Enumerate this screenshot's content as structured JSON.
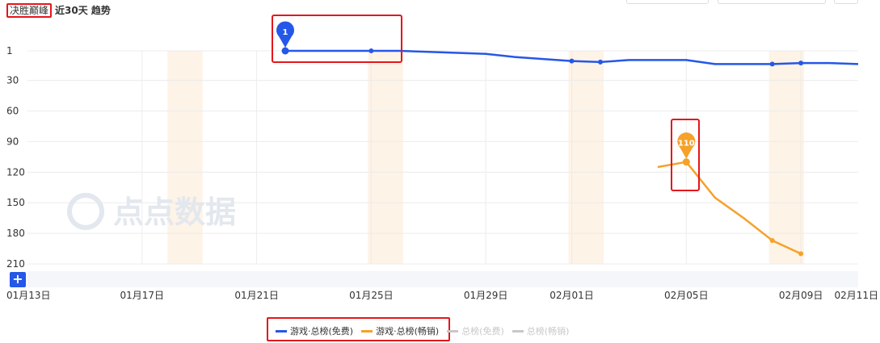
{
  "header": {
    "app_name": "决胜巅峰",
    "period": "近30天 趋势"
  },
  "watermark": "点点数据",
  "zoom_button": "+",
  "colors": {
    "free": "#2557e8",
    "grossing": "#f5a12a",
    "inactive": "#c8c8c8",
    "highlight_box": "#e4161b",
    "band": "#fdf3e6"
  },
  "chart_data": {
    "type": "line",
    "x_tick_labels": [
      "01月13日",
      "01月17日",
      "01月21日",
      "01月25日",
      "01月29日",
      "02月01日",
      "02月05日",
      "02月09日",
      "02月11日"
    ],
    "x_range": [
      "01-13",
      "02-11"
    ],
    "y_tick_labels": [
      "1",
      "30",
      "60",
      "90",
      "120",
      "150",
      "180",
      "210"
    ],
    "y_range": [
      1,
      210
    ],
    "y_inverted": true,
    "grid": true,
    "legend_position": "bottom",
    "weekend_bands": [
      [
        "01-18",
        "01-19"
      ],
      [
        "01-25",
        "01-26"
      ],
      [
        "02-01",
        "02-02"
      ],
      [
        "02-08",
        "02-09"
      ]
    ],
    "series": [
      {
        "name": "游戏·总榜(免费)",
        "x": [
          "01-22",
          "01-25",
          "01-26",
          "01-27",
          "01-28",
          "01-29",
          "01-30",
          "01-31",
          "02-01",
          "02-02",
          "02-03",
          "02-04",
          "02-05",
          "02-06",
          "02-07",
          "02-08",
          "02-09",
          "02-10",
          "02-11"
        ],
        "y": [
          1,
          1,
          1,
          2,
          3,
          4,
          7,
          9,
          11,
          12,
          10,
          10,
          10,
          14,
          14,
          14,
          13,
          13,
          14
        ],
        "markers": [
          "01-22",
          "01-25",
          "02-01",
          "02-02",
          "02-08",
          "02-09"
        ],
        "peak_label": {
          "x": "01-22",
          "value": "1"
        }
      },
      {
        "name": "游戏·总榜(畅销)",
        "x": [
          "02-04",
          "02-05",
          "02-06",
          "02-07",
          "02-08",
          "02-09"
        ],
        "y": [
          115,
          110,
          145,
          165,
          187,
          200
        ],
        "markers": [
          "02-05",
          "02-08",
          "02-09"
        ],
        "peak_label": {
          "x": "02-05",
          "value": "110"
        }
      },
      {
        "name": "总榜(免费)",
        "x": [],
        "y": [],
        "inactive": true
      },
      {
        "name": "总榜(畅销)",
        "x": [],
        "y": [],
        "inactive": true
      }
    ]
  }
}
